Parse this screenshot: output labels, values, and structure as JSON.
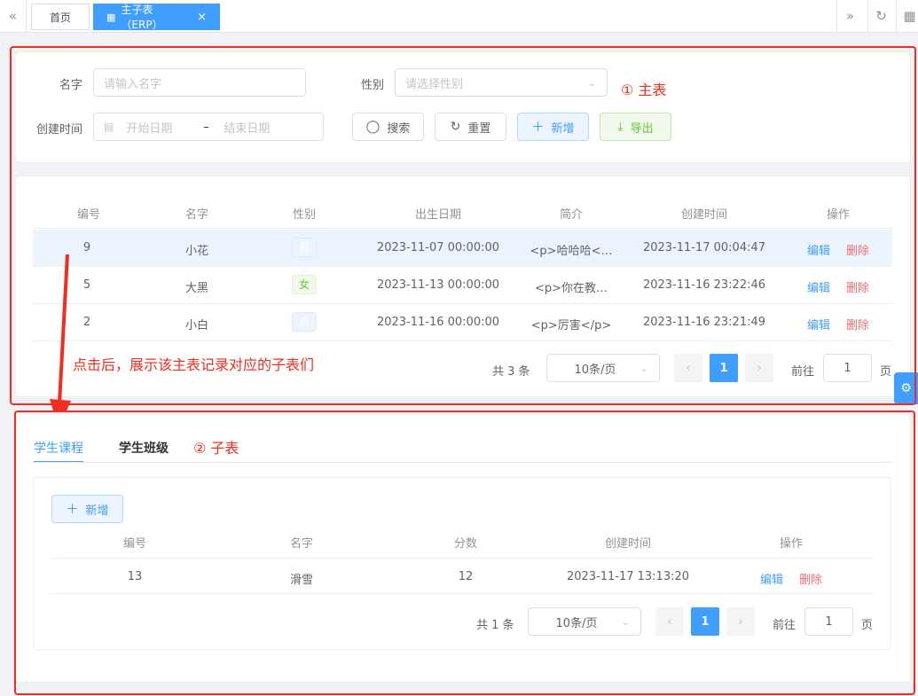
{
  "tabs": {
    "home": "首页",
    "active": "主子表（ERP）",
    "close_glyph": "×"
  },
  "search": {
    "name_label": "名字",
    "name_placeholder": "请输入名字",
    "sex_label": "性别",
    "sex_placeholder": "请选择性别",
    "created_label": "创建时间",
    "start_placeholder": "开始日期",
    "range_sep": "–",
    "end_placeholder": "结束日期",
    "btn_search": "搜索",
    "btn_reset": "重置",
    "btn_add": "新增",
    "btn_export": "导出"
  },
  "annotations": {
    "main": "① 主表",
    "sub": "② 子表",
    "hint": "点击后，展示该主表记录对应的子表们"
  },
  "main_table": {
    "headers": [
      "编号",
      "名字",
      "性别",
      "出生日期",
      "简介",
      "创建时间",
      "操作"
    ],
    "rows": [
      {
        "id": "9",
        "name": "小花",
        "sex": "男",
        "birthday": "2023-11-07 00:00:00",
        "desc": "<p>哈哈哈<…",
        "created": "2023-11-17 00:04:47",
        "edit": "编辑",
        "del": "删除"
      },
      {
        "id": "5",
        "name": "大黑",
        "sex": "女",
        "birthday": "2023-11-13 00:00:00",
        "desc": "<p>你在教…",
        "created": "2023-11-16 23:22:46",
        "edit": "编辑",
        "del": "删除"
      },
      {
        "id": "2",
        "name": "小白",
        "sex": "男",
        "birthday": "2023-11-16 00:00:00",
        "desc": "<p>厉害</p>",
        "created": "2023-11-16 23:21:49",
        "edit": "编辑",
        "del": "删除"
      }
    ],
    "pagination": {
      "total": "共 3 条",
      "size": "10条/页",
      "page": "1",
      "goto": "前往",
      "goto_value": "1",
      "page_unit": "页"
    }
  },
  "sub_tabs": [
    "学生课程",
    "学生班级"
  ],
  "sub_table": {
    "btn_add": "新增",
    "headers": [
      "编号",
      "名字",
      "分数",
      "创建时间",
      "操作"
    ],
    "rows": [
      {
        "id": "13",
        "name": "滑雪",
        "score": "12",
        "created": "2023-11-17 13:13:20",
        "edit": "编辑",
        "del": "删除"
      }
    ],
    "pagination": {
      "total": "共 1 条",
      "size": "10条/页",
      "page": "1",
      "goto": "前往",
      "goto_value": "1",
      "page_unit": "页"
    }
  }
}
